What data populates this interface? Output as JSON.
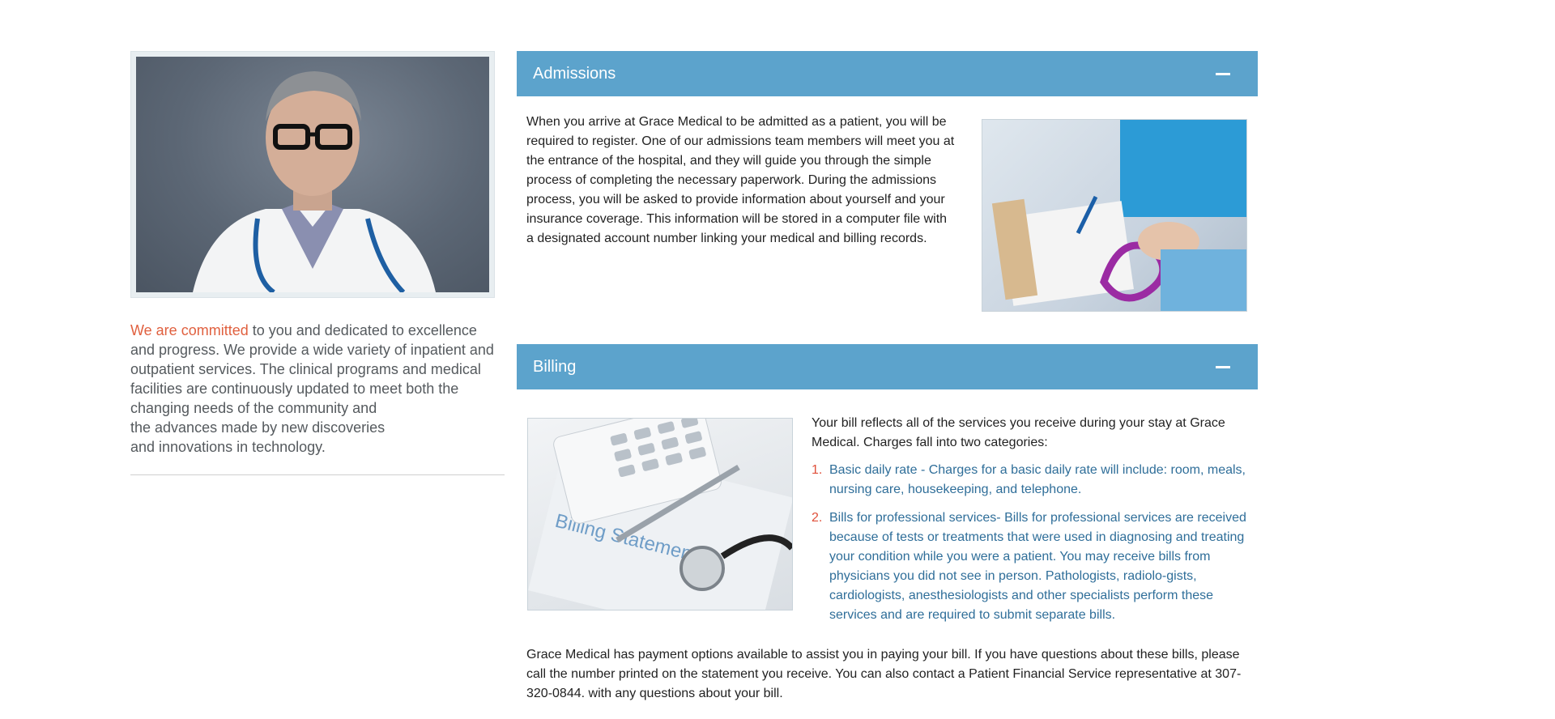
{
  "sidebar": {
    "intro_accent": "We are committed",
    "intro_rest": " to you and dedicated to excellence and progress. We provide a wide variety of inpatient and outpatient services. The clinical programs and medical facilities are continuously updated to meet both the changing needs of the community and",
    "intro_line2": "the advances made by new discoveries",
    "intro_line3": "and innovations in technology."
  },
  "admissions": {
    "title": "Admissions",
    "body": "When you arrive at Grace Medical to be admitted as a patient, you will be required to register. One of our admissions team members will meet you at the entrance of the hospital, and they will guide you through the simple process of completing the necessary paperwork. During the admissions process, you will be asked to provide information about yourself and your insurance coverage. This information will be stored in a computer file with a designated account number linking your medical and billing records."
  },
  "billing": {
    "title": "Billing",
    "image_caption": "Billing Statement",
    "intro": "Your bill reflects all of the services you receive during your stay at Grace Medical. Charges fall into two categories:",
    "items": [
      {
        "num": "1.",
        "text": "Basic daily rate - Charges for a basic daily rate will include: room, meals, nursing care, housekeeping, and telephone."
      },
      {
        "num": "2.",
        "text": "Bills for professional services- Bills for professional services are received because of tests or treatments that were used in diagnosing and treating your condition while you were a patient. You may receive bills from physicians you did not see in person. Pathologists, radiolo-gists, cardiologists, anesthesiologists and other specialists perform these services and are required to submit separate bills."
      }
    ],
    "footer": "Grace Medical has payment options available to assist you in paying your bill. If you have questions about these bills, please call the number printed on the statement you receive. You can also contact a Patient Financial Service representative at 307-320-0844. with any questions about your bill."
  },
  "colors": {
    "panel_header": "#5ca3cc",
    "accent": "#e0603f",
    "list_text": "#2f6e99"
  }
}
